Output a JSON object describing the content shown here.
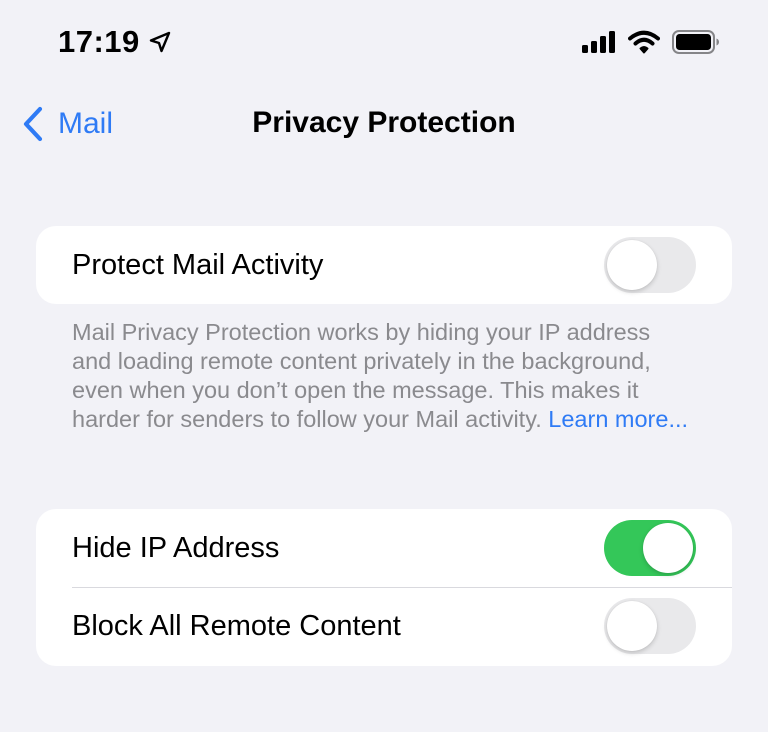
{
  "status_bar": {
    "time": "17:19",
    "icons": [
      "location-arrow-icon",
      "cellular-signal-icon",
      "wifi-icon",
      "battery-icon"
    ]
  },
  "nav": {
    "back_label": "Mail",
    "title": "Privacy Protection"
  },
  "settings": {
    "protect_mail_activity": {
      "label": "Protect Mail Activity",
      "enabled": false
    },
    "description": "Mail Privacy Protection works by hiding your IP address and loading remote content privately in the background, even when you don’t open the message. This makes it harder for senders to follow your Mail activity.",
    "learn_more": "Learn more...",
    "hide_ip_address": {
      "label": "Hide IP Address",
      "enabled": true
    },
    "block_remote_content": {
      "label": "Block All Remote Content",
      "enabled": false
    }
  },
  "colors": {
    "accent": "#2f7bf5",
    "toggle_on": "#34c759",
    "toggle_off": "#e9e9eb",
    "background": "#f2f2f7",
    "footer_text": "#8a8a8e"
  }
}
